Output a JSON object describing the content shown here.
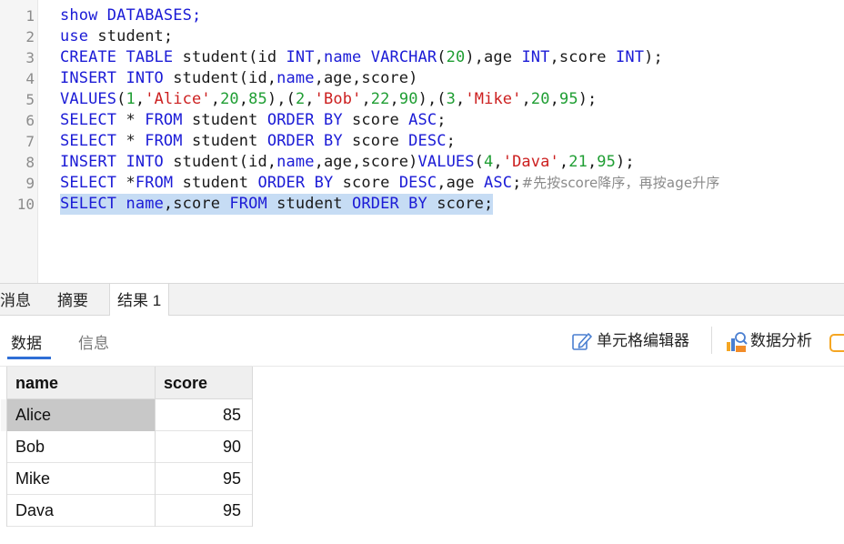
{
  "editor": {
    "line_numbers": [
      "1",
      "2",
      "3",
      "4",
      "5",
      "6",
      "7",
      "8",
      "9",
      "10"
    ],
    "lines": [
      [
        {
          "t": "show DATABASES;",
          "c": "kw"
        }
      ],
      [
        {
          "t": "use",
          "c": "kw"
        },
        {
          "t": " student;",
          "c": ""
        }
      ],
      [
        {
          "t": "CREATE TABLE",
          "c": "kw"
        },
        {
          "t": " student(id ",
          "c": ""
        },
        {
          "t": "INT",
          "c": "kw"
        },
        {
          "t": ",",
          "c": ""
        },
        {
          "t": "name",
          "c": "kw"
        },
        {
          "t": " ",
          "c": ""
        },
        {
          "t": "VARCHAR",
          "c": "kw"
        },
        {
          "t": "(",
          "c": ""
        },
        {
          "t": "20",
          "c": "num"
        },
        {
          "t": "),age ",
          "c": ""
        },
        {
          "t": "INT",
          "c": "kw"
        },
        {
          "t": ",score ",
          "c": ""
        },
        {
          "t": "INT",
          "c": "kw"
        },
        {
          "t": ");",
          "c": ""
        }
      ],
      [
        {
          "t": "INSERT INTO",
          "c": "kw"
        },
        {
          "t": " student(id,",
          "c": ""
        },
        {
          "t": "name",
          "c": "kw"
        },
        {
          "t": ",age,score)",
          "c": ""
        }
      ],
      [
        {
          "t": "VALUES",
          "c": "kw"
        },
        {
          "t": "(",
          "c": ""
        },
        {
          "t": "1",
          "c": "num"
        },
        {
          "t": ",",
          "c": ""
        },
        {
          "t": "'Alice'",
          "c": "str"
        },
        {
          "t": ",",
          "c": ""
        },
        {
          "t": "20",
          "c": "num"
        },
        {
          "t": ",",
          "c": ""
        },
        {
          "t": "85",
          "c": "num"
        },
        {
          "t": "),(",
          "c": ""
        },
        {
          "t": "2",
          "c": "num"
        },
        {
          "t": ",",
          "c": ""
        },
        {
          "t": "'Bob'",
          "c": "str"
        },
        {
          "t": ",",
          "c": ""
        },
        {
          "t": "22",
          "c": "num"
        },
        {
          "t": ",",
          "c": ""
        },
        {
          "t": "90",
          "c": "num"
        },
        {
          "t": "),(",
          "c": ""
        },
        {
          "t": "3",
          "c": "num"
        },
        {
          "t": ",",
          "c": ""
        },
        {
          "t": "'Mike'",
          "c": "str"
        },
        {
          "t": ",",
          "c": ""
        },
        {
          "t": "20",
          "c": "num"
        },
        {
          "t": ",",
          "c": ""
        },
        {
          "t": "95",
          "c": "num"
        },
        {
          "t": ");",
          "c": ""
        }
      ],
      [
        {
          "t": "SELECT",
          "c": "kw"
        },
        {
          "t": " * ",
          "c": ""
        },
        {
          "t": "FROM",
          "c": "kw"
        },
        {
          "t": " student ",
          "c": ""
        },
        {
          "t": "ORDER BY",
          "c": "kw"
        },
        {
          "t": " score ",
          "c": ""
        },
        {
          "t": "ASC",
          "c": "kw"
        },
        {
          "t": ";",
          "c": ""
        }
      ],
      [
        {
          "t": "SELECT",
          "c": "kw"
        },
        {
          "t": " * ",
          "c": ""
        },
        {
          "t": "FROM",
          "c": "kw"
        },
        {
          "t": " student ",
          "c": ""
        },
        {
          "t": "ORDER BY",
          "c": "kw"
        },
        {
          "t": " score ",
          "c": ""
        },
        {
          "t": "DESC",
          "c": "kw"
        },
        {
          "t": ";",
          "c": ""
        }
      ],
      [
        {
          "t": "INSERT INTO",
          "c": "kw"
        },
        {
          "t": " student(id,",
          "c": ""
        },
        {
          "t": "name",
          "c": "kw"
        },
        {
          "t": ",age,score)",
          "c": ""
        },
        {
          "t": "VALUES",
          "c": "kw"
        },
        {
          "t": "(",
          "c": ""
        },
        {
          "t": "4",
          "c": "num"
        },
        {
          "t": ",",
          "c": ""
        },
        {
          "t": "'Dava'",
          "c": "str"
        },
        {
          "t": ",",
          "c": ""
        },
        {
          "t": "21",
          "c": "num"
        },
        {
          "t": ",",
          "c": ""
        },
        {
          "t": "95",
          "c": "num"
        },
        {
          "t": ");",
          "c": ""
        }
      ],
      [
        {
          "t": "SELECT",
          "c": "kw"
        },
        {
          "t": " *",
          "c": ""
        },
        {
          "t": "FROM",
          "c": "kw"
        },
        {
          "t": " student ",
          "c": ""
        },
        {
          "t": "ORDER BY",
          "c": "kw"
        },
        {
          "t": " score ",
          "c": ""
        },
        {
          "t": "DESC",
          "c": "kw"
        },
        {
          "t": ",age ",
          "c": ""
        },
        {
          "t": "ASC",
          "c": "kw"
        },
        {
          "t": ";",
          "c": ""
        },
        {
          "t": "#先按score降序，再按age升序",
          "c": "cmt"
        }
      ],
      [
        {
          "t": "SELECT",
          "c": "kw"
        },
        {
          "t": " ",
          "c": ""
        },
        {
          "t": "name",
          "c": "kw"
        },
        {
          "t": ",score ",
          "c": ""
        },
        {
          "t": "FROM",
          "c": "kw"
        },
        {
          "t": " student ",
          "c": ""
        },
        {
          "t": "ORDER BY",
          "c": "kw"
        },
        {
          "t": " score;",
          "c": ""
        }
      ]
    ],
    "selected_line": 10
  },
  "panel_tabs": [
    "消息",
    "摘要",
    "结果 1"
  ],
  "active_panel_tab": "结果 1",
  "sub_tabs": {
    "data": "数据",
    "info": "信息"
  },
  "toolbar": {
    "cell_editor": "单元格编辑器",
    "data_analysis": "数据分析"
  },
  "icons": {
    "cell_editor": "edit-pencil-icon",
    "data_analysis": "data-analysis-icon"
  },
  "result": {
    "columns": [
      "name",
      "score"
    ],
    "rows": [
      {
        "name": "Alice",
        "score": "85"
      },
      {
        "name": "Bob",
        "score": "90"
      },
      {
        "name": "Mike",
        "score": "95"
      },
      {
        "name": "Dava",
        "score": "95"
      }
    ]
  },
  "colors": {
    "keyword": "#1b1bd6",
    "string": "#cc1f1f",
    "number": "#1f9e33",
    "comment": "#8a8a8a",
    "selection": "#c6dcf4",
    "accent": "#2f6fd6"
  }
}
